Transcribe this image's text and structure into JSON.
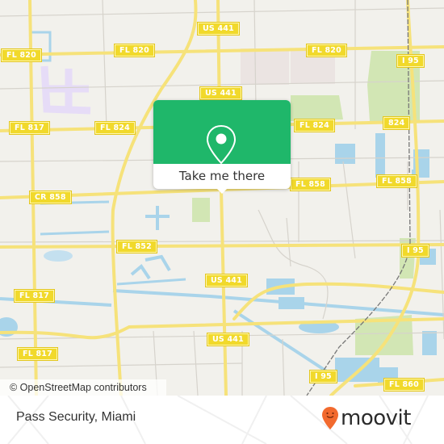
{
  "map": {
    "attribution": "© OpenStreetMap contributors",
    "colors": {
      "background": "#f2f1ec",
      "road_major": "#f6e27a",
      "road_minor": "#d6d3cc",
      "water": "#a9d4ea",
      "park": "#d2e6b4",
      "shield": "#f1d92b",
      "popup_green": "#1fb76a"
    },
    "road_labels": [
      {
        "id": "fl820-w",
        "text": "FL 820"
      },
      {
        "id": "fl820-c",
        "text": "FL 820"
      },
      {
        "id": "fl820-e",
        "text": "FL 820"
      },
      {
        "id": "us441-n",
        "text": "US 441"
      },
      {
        "id": "us441-n2",
        "text": "US 441"
      },
      {
        "id": "i95-n",
        "text": "I 95"
      },
      {
        "id": "fl817-n",
        "text": "FL 817"
      },
      {
        "id": "fl824-w",
        "text": "FL 824"
      },
      {
        "id": "fl824-e",
        "text": "FL 824"
      },
      {
        "id": "824-e",
        "text": "824"
      },
      {
        "id": "cr858",
        "text": "CR 858"
      },
      {
        "id": "fl858-c",
        "text": "FL 858"
      },
      {
        "id": "fl858-e",
        "text": "FL 858"
      },
      {
        "id": "fl852",
        "text": "FL 852"
      },
      {
        "id": "i95-m",
        "text": "I 95"
      },
      {
        "id": "us441-m",
        "text": "US 441"
      },
      {
        "id": "fl817-m",
        "text": "FL 817"
      },
      {
        "id": "us441-s",
        "text": "US 441"
      },
      {
        "id": "fl817-s",
        "text": "FL 817"
      },
      {
        "id": "i95-s",
        "text": "I 95"
      },
      {
        "id": "fl860",
        "text": "FL 860"
      }
    ]
  },
  "popup": {
    "icon": "map-pin-icon",
    "cta_label": "Take me there"
  },
  "footer": {
    "place_name": "Pass Security, Miami",
    "brand": "moovit",
    "brand_icon": "moovit-pin-icon",
    "brand_color": "#f26a2e"
  }
}
